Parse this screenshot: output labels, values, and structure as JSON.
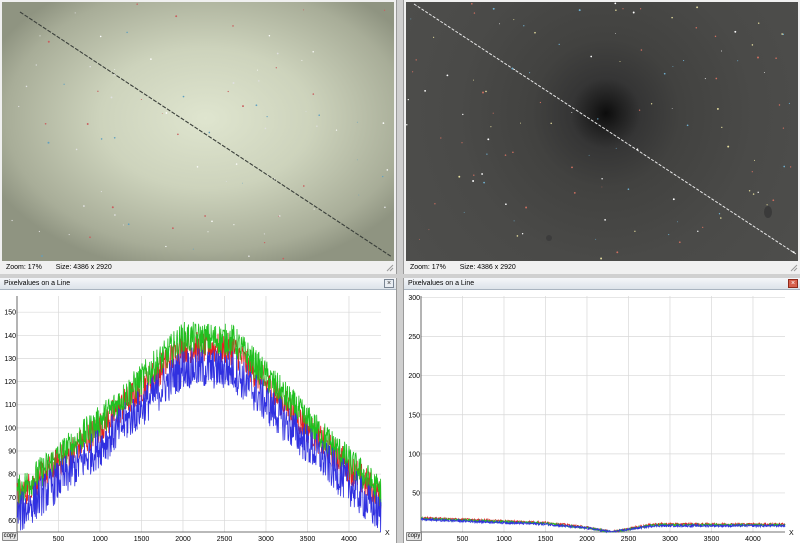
{
  "top_left": {
    "zoom_text": "Zoom: 17%",
    "size_text": "Size: 4386 x 2920"
  },
  "top_right": {
    "zoom_text": "Zoom: 17%",
    "size_text": "Size: 4386 x 2920"
  },
  "bottom_left": {
    "title": "Pixelvalues on a Line",
    "close_label": "×",
    "copy_label": "copy"
  },
  "bottom_right": {
    "title": "Pixelvalues on a Line",
    "close_label": "×",
    "copy_label": "copy"
  },
  "colors": {
    "red": "#e02020",
    "green": "#20c020",
    "blue": "#3030e0"
  },
  "chart_data": [
    {
      "type": "line",
      "x_ticks": [
        500,
        1000,
        1500,
        2000,
        2500,
        3000,
        3500,
        4000
      ],
      "y_ticks": [
        60,
        70,
        80,
        90,
        100,
        110,
        120,
        130,
        140,
        150
      ],
      "xlim": [
        0,
        4386
      ],
      "ylim": [
        55,
        157
      ],
      "xlabel": "X",
      "grid": true,
      "series": [
        {
          "color": "red",
          "profile": [
            [
              0,
              70
            ],
            [
              1000,
              100
            ],
            [
              2000,
              135
            ],
            [
              2600,
              134
            ],
            [
              3500,
              100
            ],
            [
              4386,
              70
            ]
          ],
          "noise": 7
        },
        {
          "color": "green",
          "profile": [
            [
              0,
              72
            ],
            [
              1000,
              103
            ],
            [
              2000,
              139
            ],
            [
              2600,
              138
            ],
            [
              3500,
              103
            ],
            [
              4386,
              72
            ]
          ],
          "noise": 7
        },
        {
          "color": "blue",
          "profile": [
            [
              0,
              62
            ],
            [
              1000,
              92
            ],
            [
              2000,
              126
            ],
            [
              2600,
              125
            ],
            [
              3500,
              93
            ],
            [
              4386,
              62
            ]
          ],
          "noise": 9
        }
      ]
    },
    {
      "type": "line",
      "x_ticks": [
        500,
        1000,
        1500,
        2000,
        2500,
        3000,
        3500,
        4000
      ],
      "y_ticks": [
        50,
        100,
        150,
        200,
        250,
        300
      ],
      "xlim": [
        0,
        4386
      ],
      "ylim": [
        0,
        302
      ],
      "xlabel": "X",
      "grid": true,
      "series": [
        {
          "color": "red",
          "profile": [
            [
              0,
              18
            ],
            [
              1500,
              12
            ],
            [
              2000,
              6
            ],
            [
              2300,
              0
            ],
            [
              2800,
              10
            ],
            [
              4386,
              10
            ]
          ],
          "noise": 1.5
        },
        {
          "color": "green",
          "profile": [
            [
              0,
              17
            ],
            [
              1500,
              11
            ],
            [
              2000,
              5
            ],
            [
              2300,
              0
            ],
            [
              2800,
              9
            ],
            [
              4386,
              9
            ]
          ],
          "noise": 1.5
        },
        {
          "color": "blue",
          "profile": [
            [
              0,
              16
            ],
            [
              1500,
              10
            ],
            [
              2000,
              5
            ],
            [
              2300,
              0
            ],
            [
              2800,
              8
            ],
            [
              4386,
              8
            ]
          ],
          "noise": 1.5
        }
      ]
    }
  ]
}
